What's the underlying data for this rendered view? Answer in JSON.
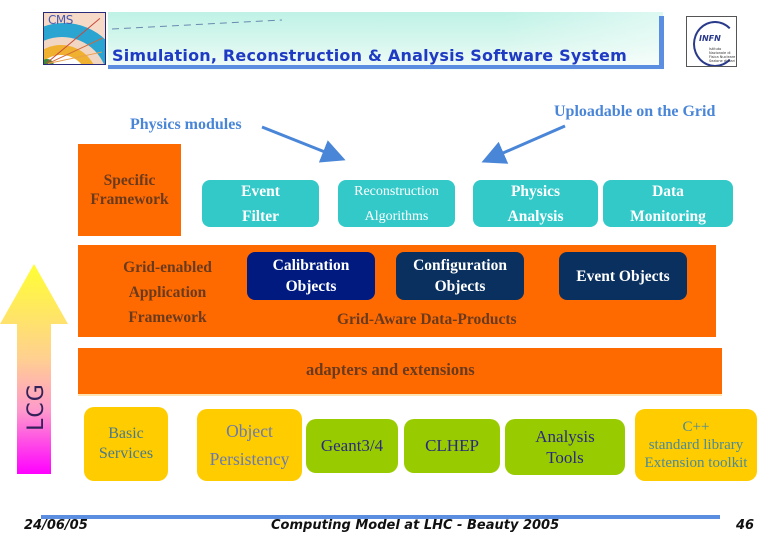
{
  "header": {
    "title": "Simulation, Reconstruction & Analysis Software System",
    "left_logo": {
      "icon": "cms-logo-icon",
      "text": "CMS"
    },
    "right_logo": {
      "icon": "infn-logo-icon",
      "text": "INFN",
      "subtext": "Istituto Nazionale di Fisica Nucleare Sezione di Bari"
    }
  },
  "labels": {
    "physics_modules": "Physics modules",
    "uploadable": "Uploadable on the Grid"
  },
  "top_row": {
    "specific_framework": "Specific Framework",
    "modules": [
      {
        "line1": "Event",
        "line2": "Filter"
      },
      {
        "line1": "Reconstruction",
        "line2": "Algorithms"
      },
      {
        "line1": "Physics",
        "line2": "Analysis"
      },
      {
        "line1": "Data",
        "line2": "Monitoring"
      }
    ]
  },
  "grid_layer": {
    "framework": {
      "line1": "Grid-enabled",
      "line2": "Application",
      "line3": "Framework"
    },
    "objects": [
      {
        "line1": "Calibration",
        "line2": "Objects"
      },
      {
        "line1": "Configuration",
        "line2": "Objects"
      },
      {
        "line1": "Event Objects"
      }
    ],
    "data_products": "Grid-Aware Data-Products"
  },
  "adapters_layer": {
    "label": "adapters and extensions"
  },
  "lcg": {
    "label": "LCG"
  },
  "bottom_row": [
    {
      "line1": "Basic",
      "line2": "Services"
    },
    {
      "line1": "Object",
      "line2": "Persistency"
    },
    {
      "line1": "Geant3/4"
    },
    {
      "line1": "CLHEP"
    },
    {
      "line1": "Analysis",
      "line2": "Tools"
    },
    {
      "line1": "C++",
      "line2": "standard library",
      "line3": "Extension toolkit"
    }
  ],
  "footer": {
    "date": "24/06/05",
    "title": "Computing Model at LHC - Beauty 2005",
    "page": "46"
  },
  "colors": {
    "orange": "#ff6a00",
    "teal": "#33c9c9",
    "navy": "#001a80",
    "yellow": "#ffcc00",
    "green": "#99cc00",
    "accent_blue": "#5b8de0",
    "label_blue": "#4a86d8"
  }
}
